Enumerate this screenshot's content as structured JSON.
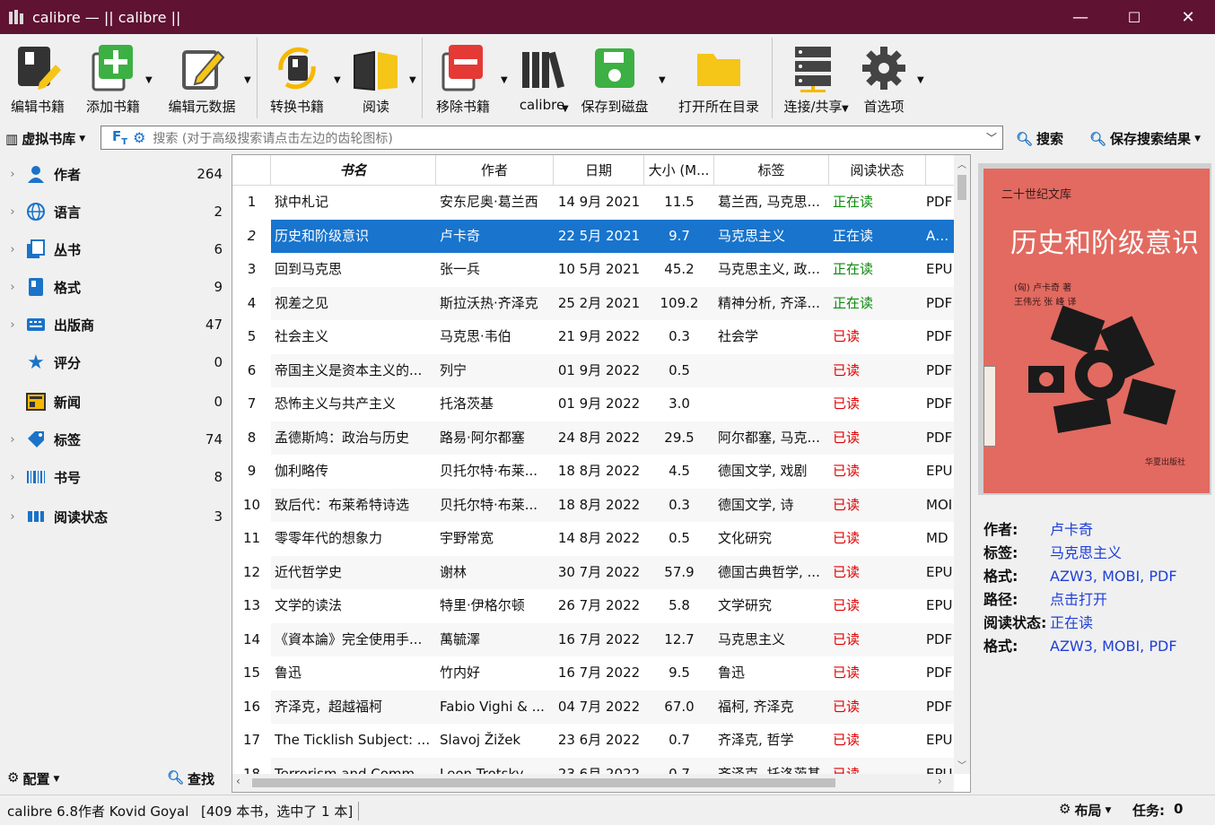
{
  "window": {
    "title": "calibre — || calibre ||",
    "minimize": "—",
    "maximize": "☐",
    "close": "✕"
  },
  "toolbar": {
    "edit_book": "编辑书籍",
    "add_book": "添加书籍",
    "edit_metadata": "编辑元数据",
    "convert": "转换书籍",
    "read": "阅读",
    "remove": "移除书籍",
    "calibre": "calibre",
    "save_to_disk": "保存到磁盘",
    "open_folder": "打开所在目录",
    "connect_share": "连接/共享",
    "preferences": "首选项"
  },
  "search": {
    "virtual_library": "虚拟书库",
    "placeholder": "搜索 (对于高级搜索请点击左边的齿轮图标)",
    "search_label": "搜索",
    "save_search_label": "保存搜索结果"
  },
  "tag_browser": {
    "items": [
      {
        "name": "作者",
        "count": "264",
        "icon": "person-icon",
        "expandable": true
      },
      {
        "name": "语言",
        "count": "2",
        "icon": "globe-icon",
        "expandable": true
      },
      {
        "name": "丛书",
        "count": "6",
        "icon": "series-icon",
        "expandable": true
      },
      {
        "name": "格式",
        "count": "9",
        "icon": "book-format-icon",
        "expandable": true
      },
      {
        "name": "出版商",
        "count": "47",
        "icon": "publisher-icon",
        "expandable": true
      },
      {
        "name": "评分",
        "count": "0",
        "icon": "star-icon",
        "expandable": false
      },
      {
        "name": "新闻",
        "count": "0",
        "icon": "news-icon",
        "expandable": false
      },
      {
        "name": "标签",
        "count": "74",
        "icon": "tag-icon",
        "expandable": true
      },
      {
        "name": "书号",
        "count": "8",
        "icon": "barcode-icon",
        "expandable": true
      },
      {
        "name": "阅读状态",
        "count": "3",
        "icon": "columns-icon",
        "expandable": true
      }
    ],
    "configure": "配置",
    "find": "查找"
  },
  "book_list": {
    "columns": [
      "书名",
      "作者",
      "日期",
      "大小 (M...",
      "标签",
      "阅读状态",
      ""
    ],
    "rows": [
      {
        "n": "1",
        "title": "狱中札记",
        "author": "安东尼奥·葛兰西",
        "date": "14 9月 2021",
        "size": "11.5",
        "tags": "葛兰西, 马克思...",
        "status": "正在读",
        "state": "reading",
        "fmt": "PDF"
      },
      {
        "n": "2",
        "title": "历史和阶级意识",
        "author": "卢卡奇",
        "date": "22 5月 2021",
        "size": "9.7",
        "tags": "马克思主义",
        "status": "正在读",
        "state": "reading",
        "fmt": "AZW"
      },
      {
        "n": "3",
        "title": "回到马克思",
        "author": "张一兵",
        "date": "10 5月 2021",
        "size": "45.2",
        "tags": "马克思主义, 政...",
        "status": "正在读",
        "state": "reading",
        "fmt": "EPU"
      },
      {
        "n": "4",
        "title": "视差之见",
        "author": "斯拉沃热·齐泽克",
        "date": "25 2月 2021",
        "size": "109.2",
        "tags": "精神分析, 齐泽...",
        "status": "正在读",
        "state": "reading",
        "fmt": "PDF"
      },
      {
        "n": "5",
        "title": "社会主义",
        "author": "马克思·韦伯",
        "date": "21 9月 2022",
        "size": "0.3",
        "tags": "社会学",
        "status": "已读",
        "state": "read",
        "fmt": "PDF"
      },
      {
        "n": "6",
        "title": "帝国主义是资本主义的...",
        "author": "列宁",
        "date": "01 9月 2022",
        "size": "0.5",
        "tags": "",
        "status": "已读",
        "state": "read",
        "fmt": "PDF"
      },
      {
        "n": "7",
        "title": "恐怖主义与共产主义",
        "author": "托洛茨基",
        "date": "01 9月 2022",
        "size": "3.0",
        "tags": "",
        "status": "已读",
        "state": "read",
        "fmt": "PDF"
      },
      {
        "n": "8",
        "title": "孟德斯鸠：政治与历史",
        "author": "路易·阿尔都塞",
        "date": "24 8月 2022",
        "size": "29.5",
        "tags": "阿尔都塞, 马克...",
        "status": "已读",
        "state": "read",
        "fmt": "PDF"
      },
      {
        "n": "9",
        "title": "伽利略传",
        "author": "贝托尔特·布莱...",
        "date": "18 8月 2022",
        "size": "4.5",
        "tags": "德国文学, 戏剧",
        "status": "已读",
        "state": "read",
        "fmt": "EPU"
      },
      {
        "n": "10",
        "title": "致后代：布莱希特诗选",
        "author": "贝托尔特·布莱...",
        "date": "18 8月 2022",
        "size": "0.3",
        "tags": "德国文学, 诗",
        "status": "已读",
        "state": "read",
        "fmt": "MOI"
      },
      {
        "n": "11",
        "title": "零零年代的想象力",
        "author": "宇野常宽",
        "date": "14 8月 2022",
        "size": "0.5",
        "tags": "文化研究",
        "status": "已读",
        "state": "read",
        "fmt": "MD"
      },
      {
        "n": "12",
        "title": "近代哲学史",
        "author": "谢林",
        "date": "30 7月 2022",
        "size": "57.9",
        "tags": "德国古典哲学, ...",
        "status": "已读",
        "state": "read",
        "fmt": "EPU"
      },
      {
        "n": "13",
        "title": "文学的读法",
        "author": "特里·伊格尔顿",
        "date": "26 7月 2022",
        "size": "5.8",
        "tags": "文学研究",
        "status": "已读",
        "state": "read",
        "fmt": "EPU"
      },
      {
        "n": "14",
        "title": "《資本論》完全使用手...",
        "author": "萬毓澤",
        "date": "16 7月 2022",
        "size": "12.7",
        "tags": "马克思主义",
        "status": "已读",
        "state": "read",
        "fmt": "PDF"
      },
      {
        "n": "15",
        "title": "鲁迅",
        "author": "竹内好",
        "date": "16 7月 2022",
        "size": "9.5",
        "tags": "鲁迅",
        "status": "已读",
        "state": "read",
        "fmt": "PDF"
      },
      {
        "n": "16",
        "title": "齐泽克，超越福柯",
        "author": "Fabio Vighi & ...",
        "date": "04 7月 2022",
        "size": "67.0",
        "tags": "福柯, 齐泽克",
        "status": "已读",
        "state": "read",
        "fmt": "PDF"
      },
      {
        "n": "17",
        "title": "The Ticklish Subject: ...",
        "author": "Slavoj Žižek",
        "date": "23 6月 2022",
        "size": "0.7",
        "tags": "齐泽克, 哲学",
        "status": "已读",
        "state": "read",
        "fmt": "EPU"
      },
      {
        "n": "18",
        "title": "Terrorism and Commu...",
        "author": "Leon Trotsky",
        "date": "23 6月 2022",
        "size": "0.7",
        "tags": "齐泽克, 托洛茨基",
        "status": "已读",
        "state": "read",
        "fmt": "EPU"
      }
    ],
    "selected_index": 1
  },
  "cover": {
    "series_text": "二十世纪文库",
    "title_text": "历史和阶级意识",
    "author_text": "(匈) 卢卡奇 著",
    "translator_text": "王伟光 张 峰 译",
    "publisher_text": "华夏出版社"
  },
  "details": [
    {
      "key": "作者:",
      "value": "卢卡奇"
    },
    {
      "key": "标签:",
      "value": "马克思主义"
    },
    {
      "key": "格式:",
      "value": "AZW3, MOBI, PDF"
    },
    {
      "key": "路径:",
      "value": "点击打开"
    },
    {
      "key": "阅读状态:",
      "value": "正在读"
    },
    {
      "key": "格式:",
      "value": "AZW3, MOBI, PDF"
    }
  ],
  "statusbar": {
    "version": "calibre 6.8作者 Kovid Goyal",
    "count": "[409 本书，选中了 1 本]",
    "layout": "布局",
    "jobs_label": "任务:",
    "jobs_count": "0"
  },
  "colors": {
    "titlebar": "#5f1232",
    "selection": "#1874cd",
    "reading": "#0a8a0a",
    "read": "#e00000",
    "link": "#1f3fd8"
  }
}
